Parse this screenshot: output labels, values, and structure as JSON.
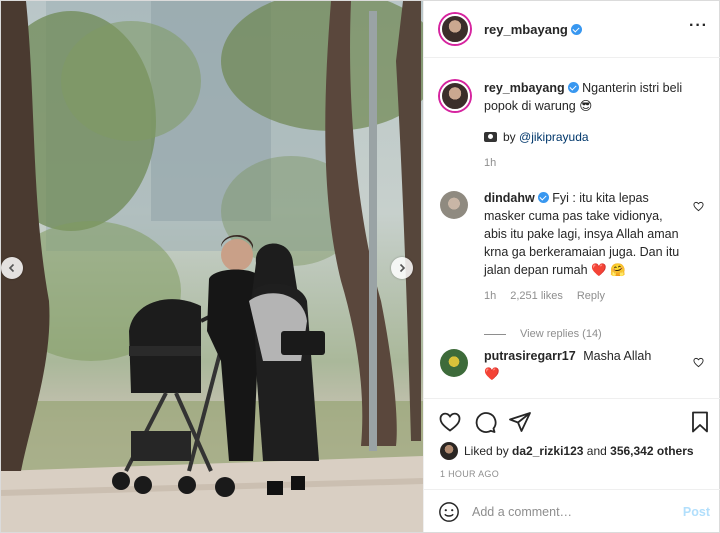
{
  "post": {
    "username": "rey_mbayang",
    "more_icon": "more-horizontal-icon",
    "caption_username": "rey_mbayang",
    "caption_text": "Nganterin istri beli popok di warung 😎",
    "credit_prefix": "by ",
    "credit_handle": "@jikiprayuda",
    "caption_time": "1h"
  },
  "comments": [
    {
      "username": "dindahw",
      "text": "Fyi : itu kita lepas masker cuma pas take vidionya, abis itu pake lagi, insya Allah aman krna ga berkeramaian juga. Dan itu jalan depan rumah",
      "emoji": "❤️ 🤗",
      "time": "1h",
      "likes": "2,251 likes",
      "reply": "Reply",
      "view_replies": "View replies (14)"
    },
    {
      "username": "putrasiregarr17",
      "text": "Masha Allah",
      "emoji": "❤️"
    }
  ],
  "actions": {
    "liked_prefix": "Liked by ",
    "liked_user": "da2_rizki123",
    "liked_mid": " and ",
    "liked_count": "356,342 others",
    "timestamp": "1 HOUR AGO",
    "comment_placeholder": "Add a comment…",
    "post_label": "Post"
  },
  "media": {
    "prev_icon": "chevron-left-icon",
    "next_icon": "chevron-right-icon"
  }
}
